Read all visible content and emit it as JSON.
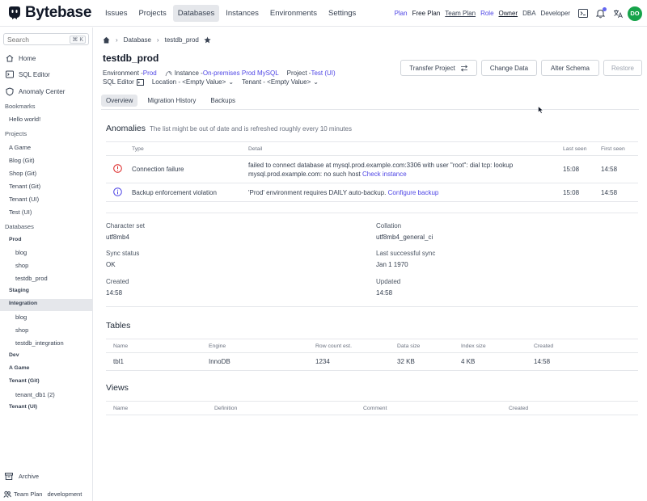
{
  "header": {
    "app_name": "Bytebase",
    "nav": [
      "Issues",
      "Projects",
      "Databases",
      "Instances",
      "Environments",
      "Settings"
    ],
    "plan_label": "Plan",
    "free_plan": "Free Plan",
    "team_plan": "Team Plan",
    "role_label": "Role",
    "roles": [
      "Owner",
      "DBA",
      "Developer"
    ],
    "avatar_initials": "DO"
  },
  "sidebar": {
    "search_placeholder": "Search",
    "search_shortcut": "⌘ K",
    "links": [
      "Home",
      "SQL Editor",
      "Anomaly Center"
    ],
    "bookmarks_label": "Bookmarks",
    "bookmarks": [
      "Hello world!"
    ],
    "projects_label": "Projects",
    "projects": [
      "A Game",
      "Blog (Git)",
      "Shop (Git)",
      "Tenant (Git)",
      "Tenant (UI)",
      "Test (UI)"
    ],
    "databases_label": "Databases",
    "env_prod": "Prod",
    "prod_dbs": [
      "blog",
      "shop",
      "testdb_prod"
    ],
    "env_staging": "Staging",
    "env_integration": "Integration",
    "integration_dbs": [
      "blog",
      "shop",
      "testdb_integration"
    ],
    "env_dev": "Dev",
    "group_a_game": "A Game",
    "group_tenant_git": "Tenant (Git)",
    "tenant_git_dbs": [
      "tenant_db1 (2)"
    ],
    "group_tenant_ui": "Tenant (UI)",
    "archive": "Archive",
    "plan": "Team Plan",
    "mode": "development"
  },
  "breadcrumb": {
    "section": "Database",
    "current": "testdb_prod"
  },
  "database": {
    "name": "testdb_prod",
    "environment_label": "Environment - ",
    "environment": "Prod",
    "instance_label": "Instance - ",
    "instance": "On-premises Prod MySQL",
    "project_label": "Project - ",
    "project": "Test (UI)",
    "sql_editor": "SQL Editor",
    "location": "Location - <Empty Value>",
    "tenant": "Tenant - <Empty Value>"
  },
  "actions": {
    "transfer": "Transfer Project",
    "change": "Change Data",
    "alter": "Alter Schema",
    "restore": "Restore"
  },
  "tabs": [
    "Overview",
    "Migration History",
    "Backups"
  ],
  "anomalies": {
    "title": "Anomalies",
    "subtitle": "The list might be out of date and is refreshed roughly every 10 minutes",
    "columns": [
      "Type",
      "Detail",
      "Last seen",
      "First seen"
    ],
    "rows": [
      {
        "type": "Connection failure",
        "detail": "failed to connect database at mysql.prod.example.com:3306 with user \"root\": dial tcp: lookup mysql.prod.example.com: no such host",
        "action": "Check instance",
        "last_seen": "15:08",
        "first_seen": "14:58",
        "severity_color": "#dc2626"
      },
      {
        "type": "Backup enforcement violation",
        "detail": "'Prod' environment requires DAILY auto-backup.",
        "action": "Configure backup",
        "last_seen": "15:08",
        "first_seen": "14:58",
        "severity_color": "#4f46e5"
      }
    ]
  },
  "info": {
    "charset_label": "Character set",
    "charset": "utf8mb4",
    "collation_label": "Collation",
    "collation": "utf8mb4_general_ci",
    "sync_status_label": "Sync status",
    "sync_status": "OK",
    "last_sync_label": "Last successful sync",
    "last_sync": "Jan 1 1970",
    "created_label": "Created",
    "created": "14:58",
    "updated_label": "Updated",
    "updated": "14:58"
  },
  "tables": {
    "title": "Tables",
    "columns": [
      "Name",
      "Engine",
      "Row count est.",
      "Data size",
      "Index size",
      "Created"
    ],
    "rows": [
      [
        "tbl1",
        "InnoDB",
        "1234",
        "32 KB",
        "4 KB",
        "14:58"
      ]
    ]
  },
  "views": {
    "title": "Views",
    "columns": [
      "Name",
      "Definition",
      "Comment",
      "Created"
    ]
  },
  "colors": {
    "accent": "#4f46e5",
    "avatar": "#16a34a",
    "error": "#dc2626",
    "notification_dot": "#6366f1"
  }
}
